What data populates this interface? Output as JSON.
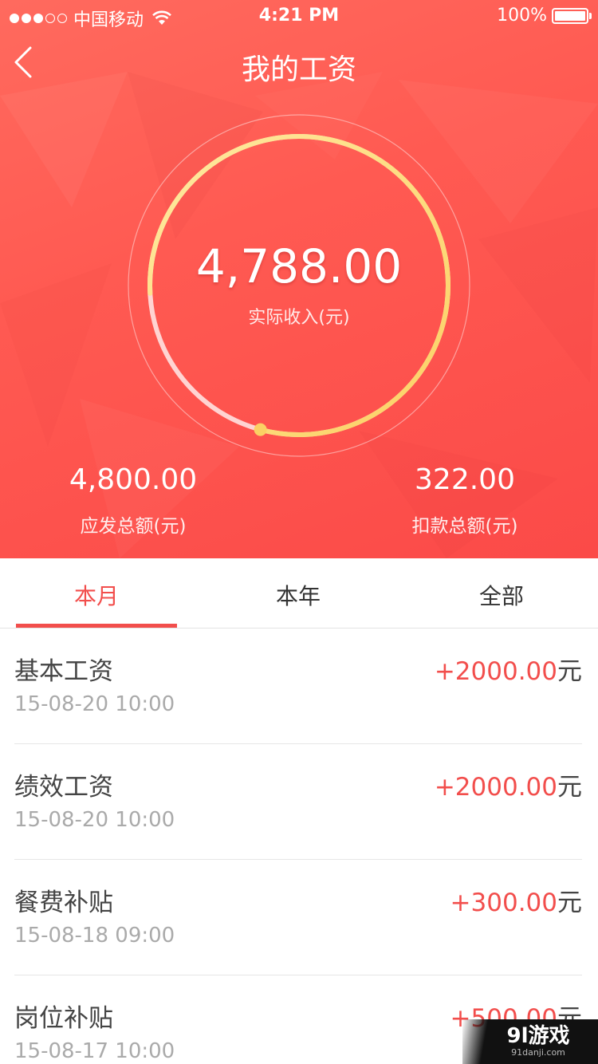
{
  "status_bar": {
    "carrier": "中国移动",
    "time": "4:21 PM",
    "battery": "100%"
  },
  "nav": {
    "title": "我的工资"
  },
  "ring": {
    "amount": "4,788.00",
    "label": "实际收入(元)",
    "progress_fraction": 0.8,
    "track_color": "#ffffff",
    "progress_color": "#fbd46a"
  },
  "summary": {
    "gross_value": "4,800.00",
    "gross_label": "应发总额(元)",
    "deduction_value": "322.00",
    "deduction_label": "扣款总额(元)"
  },
  "tabs": [
    {
      "label": "本月",
      "active": true
    },
    {
      "label": "本年",
      "active": false
    },
    {
      "label": "全部",
      "active": false
    }
  ],
  "records": [
    {
      "name": "基本工资",
      "date": "15-08-20 10:00",
      "amount": "+2000.00",
      "unit": "元"
    },
    {
      "name": "绩效工资",
      "date": "15-08-20 10:00",
      "amount": "+2000.00",
      "unit": "元"
    },
    {
      "name": "餐费补贴",
      "date": "15-08-18 09:00",
      "amount": "+300.00",
      "unit": "元"
    },
    {
      "name": "岗位补贴",
      "date": "15-08-17 10:00",
      "amount": "+500.00",
      "unit": "元"
    }
  ],
  "watermark": {
    "main": "9l游戏",
    "sub": "91danji.com"
  },
  "colors": {
    "accent": "#f24e4c",
    "hero": "#ff5a52"
  }
}
